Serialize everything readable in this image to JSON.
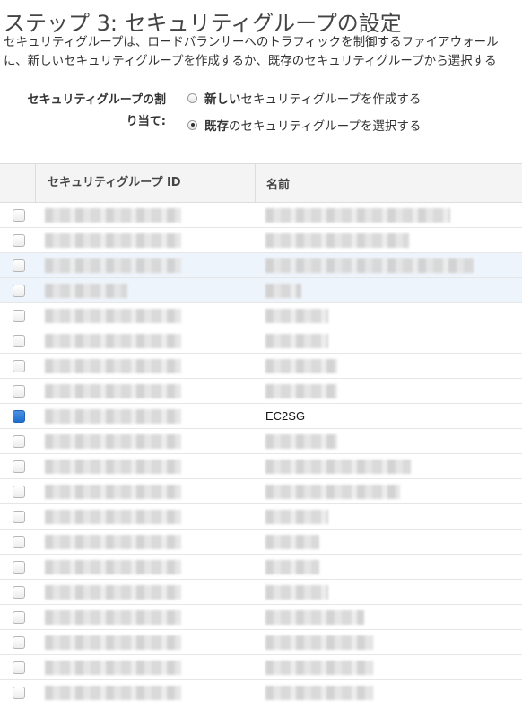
{
  "page": {
    "title": "ステップ 3: セキュリティグループの設定",
    "description_line1": "セキュリティグループは、ロードバランサーへのトラフィックを制御するファイアウォール",
    "description_line2": "に、新しいセキュリティグループを作成するか、既存のセキュリティグループから選択する"
  },
  "assign": {
    "label_line1": "セキュリティグループの割",
    "label_line2": "り当て:",
    "options": [
      {
        "bold": "新しい",
        "rest": "セキュリティグループを作成する",
        "selected": false
      },
      {
        "bold": "既存",
        "rest": "のセキュリティグループを選択する",
        "selected": true
      }
    ]
  },
  "table": {
    "columns": [
      "セキュリティグループ ID",
      "名前"
    ],
    "rows": [
      {
        "checked": false,
        "highlight": false,
        "name": ""
      },
      {
        "checked": false,
        "highlight": false,
        "name": ""
      },
      {
        "checked": false,
        "highlight": true,
        "name": ""
      },
      {
        "checked": false,
        "highlight": true,
        "name": ""
      },
      {
        "checked": false,
        "highlight": false,
        "name": ""
      },
      {
        "checked": false,
        "highlight": false,
        "name": ""
      },
      {
        "checked": false,
        "highlight": false,
        "name": ""
      },
      {
        "checked": false,
        "highlight": false,
        "name": ""
      },
      {
        "checked": true,
        "highlight": false,
        "name": "EC2SG"
      },
      {
        "checked": false,
        "highlight": false,
        "name": ""
      },
      {
        "checked": false,
        "highlight": false,
        "name": ""
      },
      {
        "checked": false,
        "highlight": false,
        "name": ""
      },
      {
        "checked": false,
        "highlight": false,
        "name": ""
      },
      {
        "checked": false,
        "highlight": false,
        "name": ""
      },
      {
        "checked": false,
        "highlight": false,
        "name": ""
      },
      {
        "checked": false,
        "highlight": false,
        "name": ""
      },
      {
        "checked": false,
        "highlight": false,
        "name": ""
      },
      {
        "checked": false,
        "highlight": false,
        "name": ""
      },
      {
        "checked": false,
        "highlight": false,
        "name": ""
      },
      {
        "checked": false,
        "highlight": false,
        "name": ""
      }
    ]
  },
  "colors": {
    "accent": "#1f6fd0",
    "highlight_row": "#eef4fb"
  }
}
